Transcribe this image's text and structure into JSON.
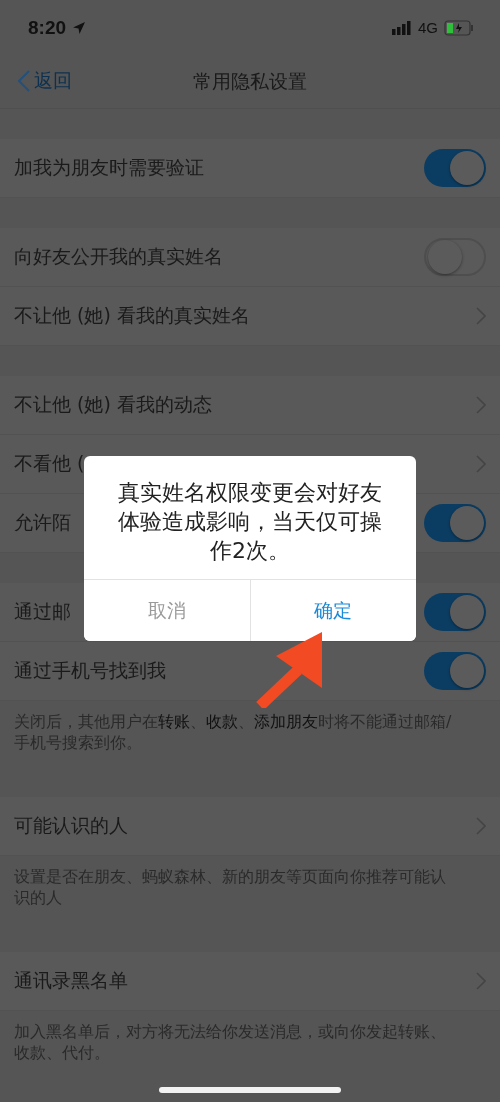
{
  "status_bar": {
    "time": "8:20",
    "network": "4G"
  },
  "nav": {
    "back": "返回",
    "title": "常用隐私设置"
  },
  "groups": [
    {
      "rows": [
        {
          "kind": "toggle",
          "label": "加我为朋友时需要验证",
          "on": true
        }
      ]
    },
    {
      "rows": [
        {
          "kind": "toggle",
          "label": "向好友公开我的真实姓名",
          "on": false
        },
        {
          "kind": "link",
          "label": "不让他 (她) 看我的真实姓名"
        }
      ]
    },
    {
      "rows": [
        {
          "kind": "link",
          "label": "不让他 (她) 看我的动态"
        },
        {
          "kind": "link",
          "label": "不看他 ("
        },
        {
          "kind": "toggle",
          "label": "允许陌",
          "on": true
        }
      ]
    },
    {
      "rows": [
        {
          "kind": "toggle",
          "label": "通过邮",
          "on": true
        },
        {
          "kind": "toggle",
          "label": "通过手机号找到我",
          "on": true
        }
      ],
      "note": "关闭后，其他用户在**转账**、**收款**、**添加朋友**时将不能通过邮箱/手机号搜索到你。"
    },
    {
      "rows": [
        {
          "kind": "link",
          "label": "可能认识的人"
        }
      ],
      "note": "设置是否在朋友、蚂蚁森林、新的朋友等页面向你推荐可能认识的人"
    },
    {
      "rows": [
        {
          "kind": "link",
          "label": "通讯录黑名单"
        }
      ],
      "note": "加入黑名单后，对方将无法给你发送消息，或向你发起转账、收款、代付。"
    }
  ],
  "dialog": {
    "message": "真实姓名权限变更会对好友体验造成影响，当天仅可操作2次。",
    "buttons": [
      {
        "label": "取消",
        "kind": "cancel"
      },
      {
        "label": "确定",
        "kind": "confirm"
      }
    ]
  }
}
